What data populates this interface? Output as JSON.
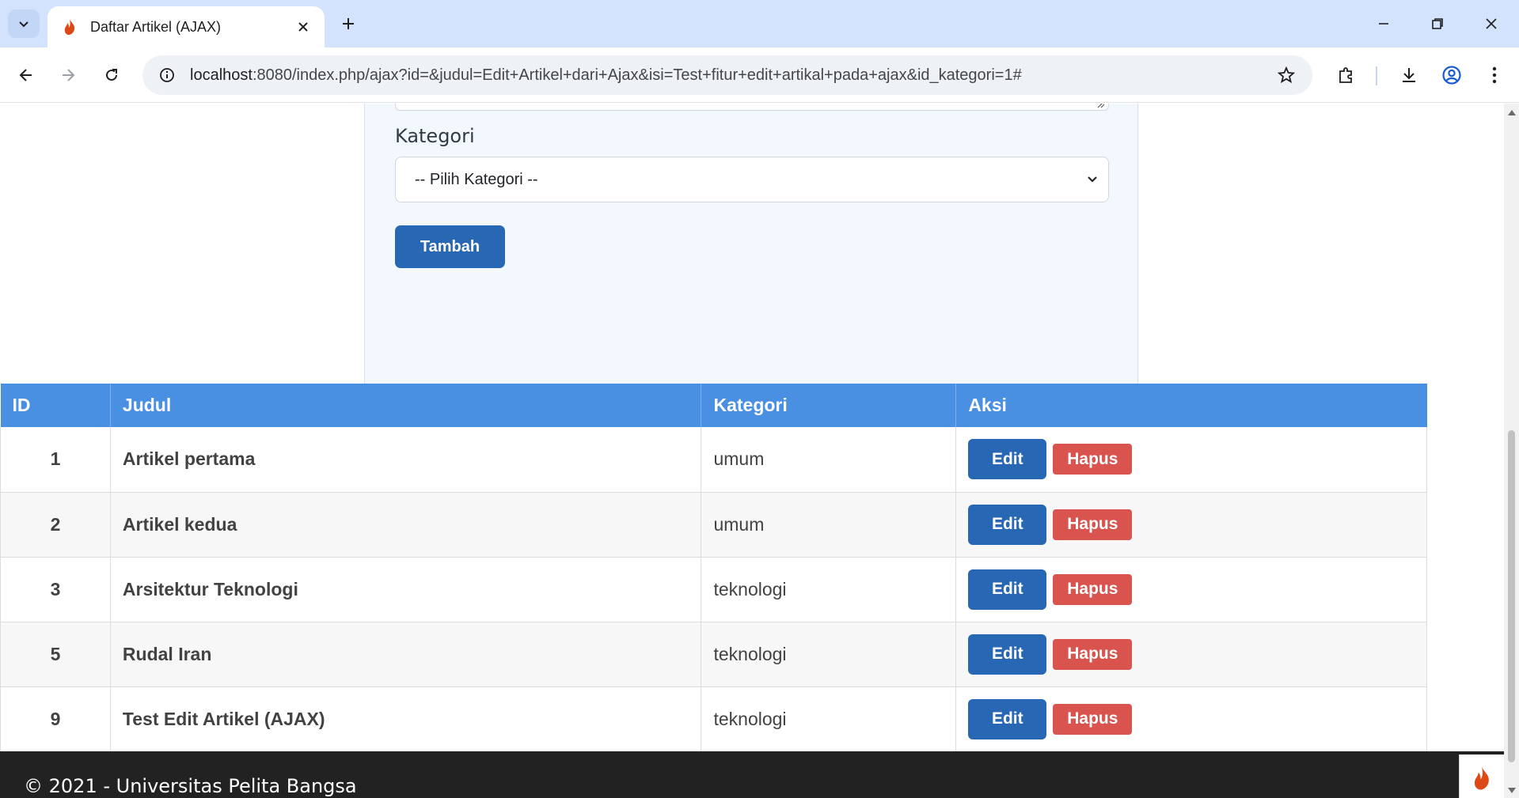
{
  "browser": {
    "tab_title": "Daftar Artikel (AJAX)",
    "url_host": "localhost",
    "url_rest": ":8080/index.php/ajax?id=&judul=Edit+Artikel+dari+Ajax&isi=Test+fitur+edit+artikal+pada+ajax&id_kategori=1#",
    "icons": [
      "tab-search-icon",
      "flame-favicon-icon",
      "close-tab-icon",
      "new-tab-icon",
      "minimize-icon",
      "restore-icon",
      "close-window-icon",
      "back-icon",
      "forward-icon",
      "reload-icon",
      "site-info-icon",
      "bookmark-star-icon",
      "extensions-icon",
      "download-icon",
      "profile-icon",
      "menu-kebab-icon"
    ]
  },
  "form": {
    "kategori_label": "Kategori",
    "kategori_selected": "-- Pilih Kategori --",
    "submit_label": "Tambah"
  },
  "table": {
    "headers": [
      "ID",
      "Judul",
      "Kategori",
      "Aksi"
    ],
    "rows": [
      {
        "id": "1",
        "judul": "Artikel pertama",
        "kategori": "umum",
        "edit": "Edit",
        "hapus": "Hapus"
      },
      {
        "id": "2",
        "judul": "Artikel kedua",
        "kategori": "umum",
        "edit": "Edit",
        "hapus": "Hapus"
      },
      {
        "id": "3",
        "judul": "Arsitektur Teknologi",
        "kategori": "teknologi",
        "edit": "Edit",
        "hapus": "Hapus"
      },
      {
        "id": "5",
        "judul": "Rudal Iran",
        "kategori": "teknologi",
        "edit": "Edit",
        "hapus": "Hapus"
      },
      {
        "id": "9",
        "judul": "Test Edit Artikel (AJAX)",
        "kategori": "teknologi",
        "edit": "Edit",
        "hapus": "Hapus"
      }
    ]
  },
  "footer": {
    "text": "© 2021 - Universitas Pelita Bangsa"
  },
  "colors": {
    "primary": "#2767b4",
    "table_header": "#4a90e2",
    "danger": "#d9534f",
    "footer_bg": "#222222",
    "tabbar_bg": "#d3e3fd"
  }
}
